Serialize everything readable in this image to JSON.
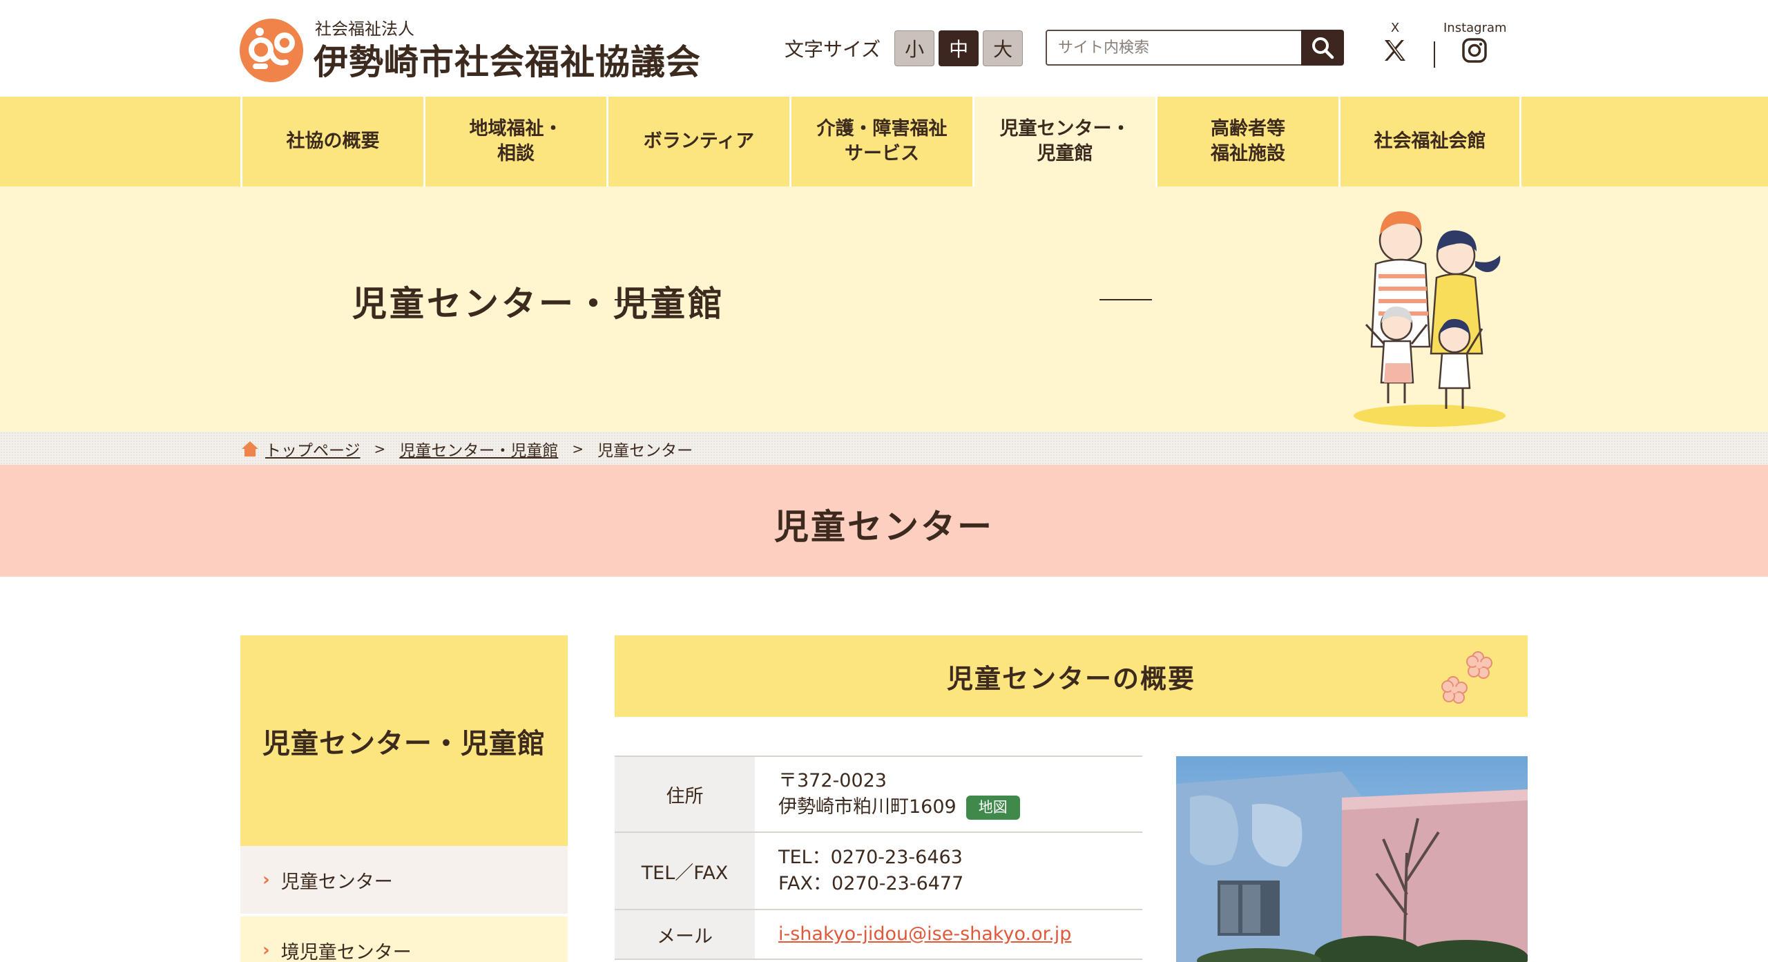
{
  "header": {
    "org_type": "社会福祉法人",
    "org_name": "伊勢崎市社会福祉協議会",
    "font_size_label": "文字サイズ",
    "font_sizes": [
      "小",
      "中",
      "大"
    ],
    "search_placeholder": "サイト内検索",
    "sns": {
      "x_label": "X",
      "instagram_label": "Instagram"
    }
  },
  "nav": [
    "社協の概要",
    "地域福祉・\n相談",
    "ボランティア",
    "介護・障害福祉\nサービス",
    "児童センター・\n児童館",
    "高齢者等\n福祉施設",
    "社会福祉会館"
  ],
  "hero": {
    "title": "児童センター・児童館"
  },
  "breadcrumb": {
    "home": "トップページ",
    "section": "児童センター・児童館",
    "current": "児童センター",
    "separator": ">"
  },
  "page_title": "児童センター",
  "sidebar": {
    "heading": "児童センター・児童館",
    "items": [
      "児童センター",
      "境児童センター"
    ],
    "chevron": "›"
  },
  "main": {
    "heading": "児童センターの概要",
    "table": {
      "address_label": "住所",
      "postal": "〒372-0023",
      "address": "伊勢崎市粕川町1609",
      "map_label": "地図",
      "telfax_label": "TEL／FAX",
      "tel": "TEL：0270-23-6463",
      "fax": "FAX：0270-23-6477",
      "mail_label": "メール",
      "mail": "i-shakyo-jidou@ise-shakyo.or.jp"
    }
  },
  "colors": {
    "brand_orange": "#f0834a",
    "nav_yellow": "#fce57f",
    "hero_cream": "#fff6cf",
    "title_pink": "#fdcfc1",
    "text_brown": "#3d2a1e",
    "map_green": "#3f8a4b",
    "link_red": "#e0593a"
  }
}
